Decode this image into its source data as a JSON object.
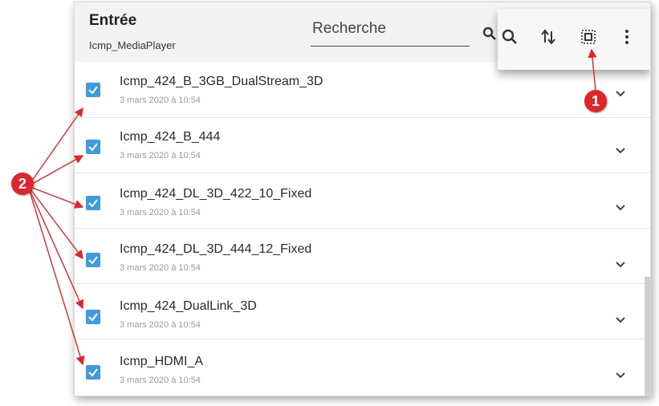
{
  "header": {
    "title": "Entrée",
    "subtitle": "Icmp_MediaPlayer",
    "search_placeholder": "Recherche"
  },
  "toolbar": {
    "icons": [
      "search-icon",
      "sort-icon",
      "select-all-icon",
      "more-vert-icon"
    ]
  },
  "items": [
    {
      "name": "Icmp_424_B_3GB_DualStream_3D",
      "date": "3 mars 2020 à 10:54",
      "checked": true
    },
    {
      "name": "Icmp_424_B_444",
      "date": "3 mars 2020 à 10:54",
      "checked": true
    },
    {
      "name": "Icmp_424_DL_3D_422_10_Fixed",
      "date": "3 mars 2020 à 10:54",
      "checked": true
    },
    {
      "name": "Icmp_424_DL_3D_444_12_Fixed",
      "date": "3 mars 2020 à 10:54",
      "checked": true
    },
    {
      "name": "Icmp_424_DualLink_3D",
      "date": "3 mars 2020 à 10:54",
      "checked": true
    },
    {
      "name": "Icmp_HDMI_A",
      "date": "3 mars 2020 à 10:54",
      "checked": true
    }
  ],
  "callouts": [
    "1",
    "2"
  ],
  "colors": {
    "accent": "#3d9be0",
    "callout": "#e0262d"
  }
}
